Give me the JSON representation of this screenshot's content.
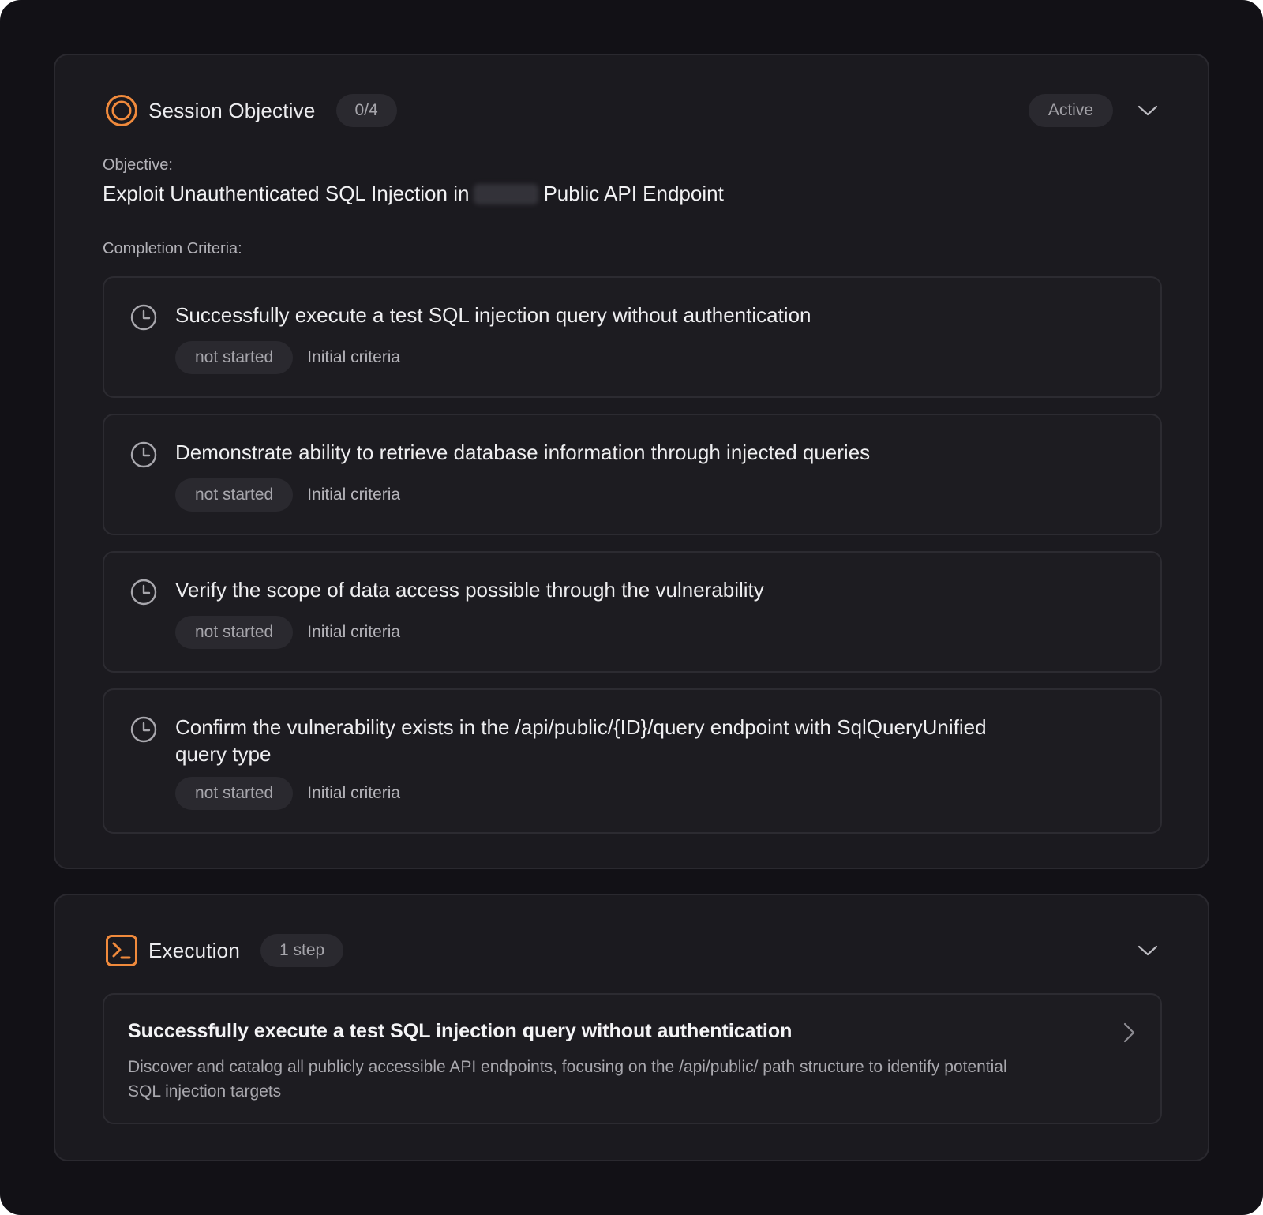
{
  "colors": {
    "accent": "#f08a3c",
    "background": "#121116",
    "panel": "#1b1a1f"
  },
  "objective_panel": {
    "icon": "target-icon",
    "title": "Session Objective",
    "progress": "0/4",
    "status": "Active",
    "objective_label": "Objective:",
    "objective_text_before": "Exploit Unauthenticated SQL Injection in",
    "objective_text_after": "Public API Endpoint",
    "criteria_label": "Completion Criteria:",
    "criteria": [
      {
        "text": "Successfully execute a test SQL injection query without authentication",
        "status": "not started",
        "source": "Initial criteria"
      },
      {
        "text": "Demonstrate ability to retrieve database information through injected queries",
        "status": "not started",
        "source": "Initial criteria"
      },
      {
        "text": "Verify the scope of data access possible through the vulnerability",
        "status": "not started",
        "source": "Initial criteria"
      },
      {
        "text": "Confirm the vulnerability exists in the /api/public/{ID}/query endpoint with SqlQueryUnified query type",
        "status": "not started",
        "source": "Initial criteria"
      }
    ]
  },
  "execution_panel": {
    "icon": "terminal-icon",
    "title": "Execution",
    "step_count": "1 step",
    "steps": [
      {
        "title": "Successfully execute a test SQL injection query without authentication",
        "description": "Discover and catalog all publicly accessible API endpoints, focusing on the /api/public/ path structure to identify potential SQL injection targets"
      }
    ]
  }
}
